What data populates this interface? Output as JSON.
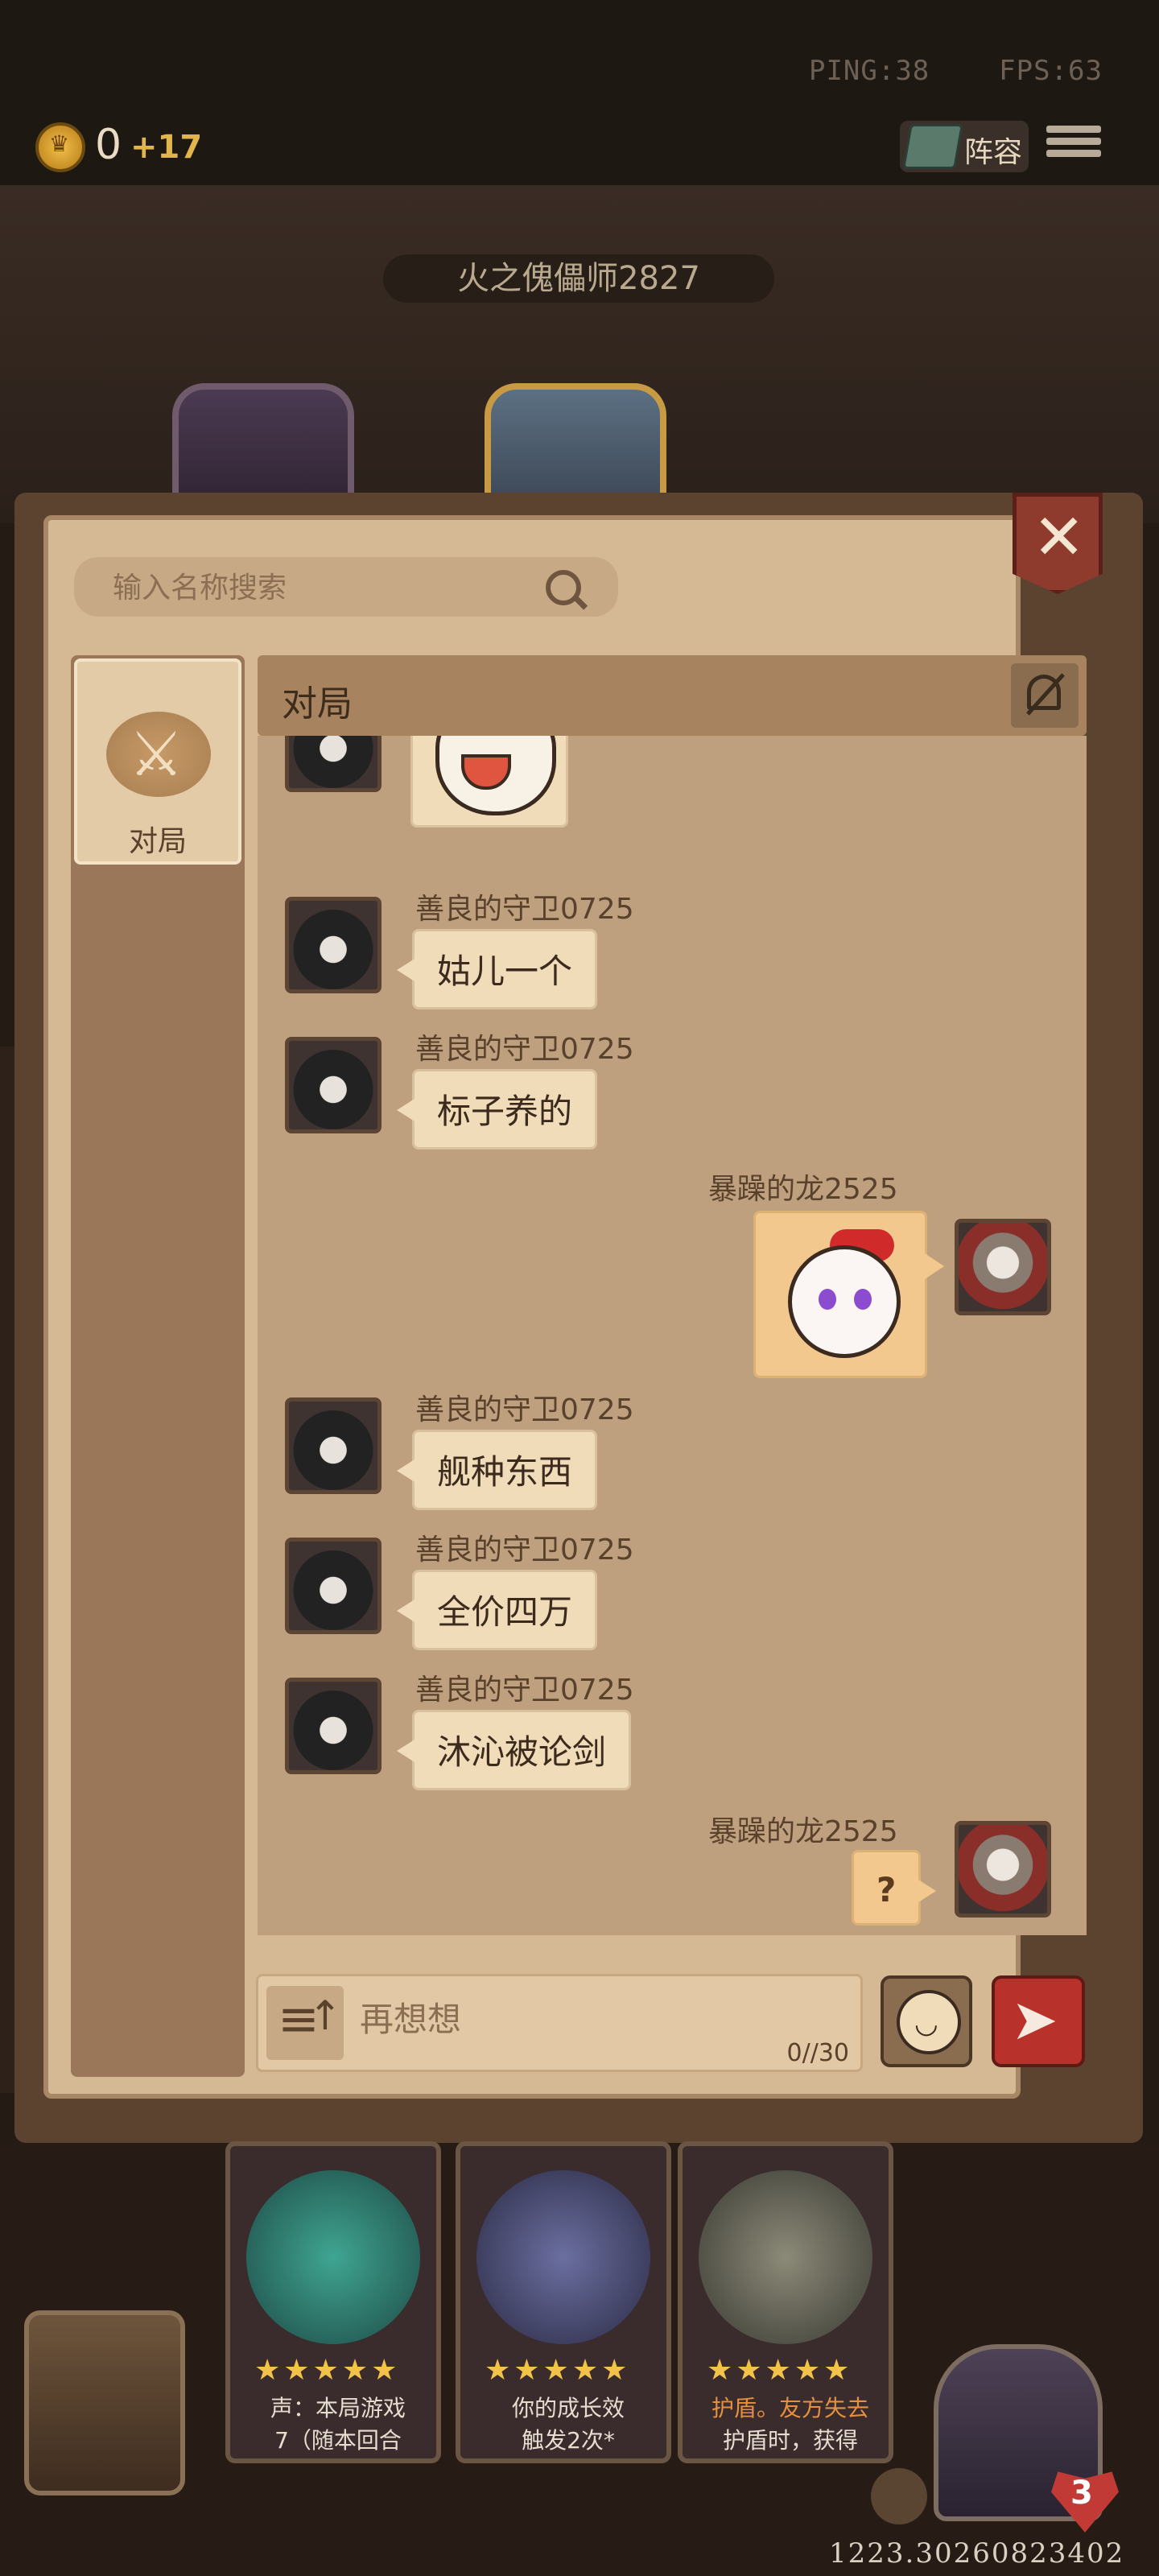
{
  "status_bar": {
    "ping": "PING:38",
    "fps": "FPS:63"
  },
  "resources": {
    "gold": "0",
    "gold_income": "+17"
  },
  "top_buttons": {
    "lineup_label": "阵容"
  },
  "opponent": {
    "name": "火之傀儡师2827"
  },
  "panel": {
    "search_placeholder": "输入名称搜索",
    "tabs": [
      {
        "label": "对局"
      }
    ],
    "chat_title": "对局"
  },
  "messages": [
    {
      "side": "left",
      "sender": "",
      "kind": "sticker",
      "sticker": "laughing-pot-sticker"
    },
    {
      "side": "left",
      "sender": "善良的守卫0725",
      "kind": "text",
      "text": "姑儿一个"
    },
    {
      "side": "left",
      "sender": "善良的守卫0725",
      "kind": "text",
      "text": "标子养的"
    },
    {
      "side": "right",
      "sender": "暴躁的龙2525",
      "kind": "sticker",
      "sticker": "clown-girl-sticker"
    },
    {
      "side": "left",
      "sender": "善良的守卫0725",
      "kind": "text",
      "text": "舰种东西"
    },
    {
      "side": "left",
      "sender": "善良的守卫0725",
      "kind": "text",
      "text": "全价四万"
    },
    {
      "side": "left",
      "sender": "善良的守卫0725",
      "kind": "text",
      "text": "沐沁被论剑"
    },
    {
      "side": "right",
      "sender": "暴躁的龙2525",
      "kind": "text",
      "text": "?"
    }
  ],
  "input": {
    "placeholder": "再想想",
    "counter": "0//30"
  },
  "cards": [
    {
      "stars": "★★★★★",
      "line1": "声：本局游戏",
      "line2": "7（随本回合"
    },
    {
      "stars": "★★★★★",
      "line1": "你的成长效",
      "line2": "触发2次*"
    },
    {
      "stars": "★★★★★",
      "line1": "护盾。友方失去",
      "line2": "护盾时，获得"
    }
  ],
  "player": {
    "health": "3",
    "id": "1223.30260823402"
  },
  "colors": {
    "accent_red": "#b8312a",
    "parchment": "#d5b894",
    "bubble_self": "#f3c88e"
  }
}
